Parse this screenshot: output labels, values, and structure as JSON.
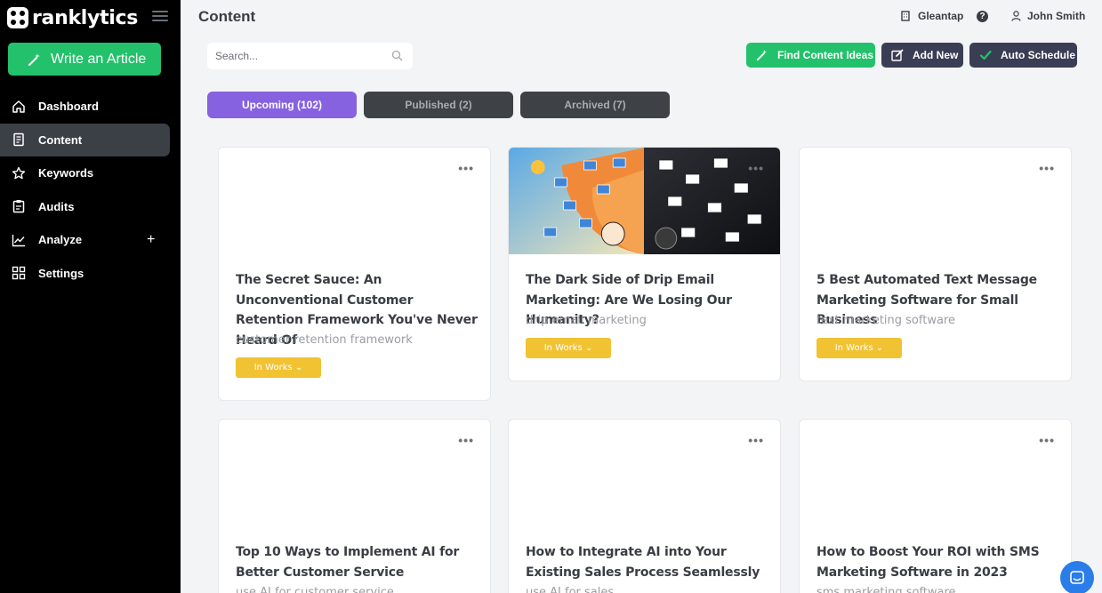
{
  "app": {
    "brand": "ranklytics"
  },
  "sidebar": {
    "write_button": "Write an Article",
    "items": [
      {
        "label": "Dashboard",
        "icon": "home-icon"
      },
      {
        "label": "Content",
        "icon": "document-icon",
        "active": true
      },
      {
        "label": "Keywords",
        "icon": "star-icon"
      },
      {
        "label": "Audits",
        "icon": "clipboard-icon"
      },
      {
        "label": "Analyze",
        "icon": "chart-line-icon",
        "expandable": "+"
      },
      {
        "label": "Settings",
        "icon": "grid-icon"
      }
    ]
  },
  "header": {
    "title": "Content",
    "workspace": "Gleantap",
    "help": "?",
    "user": "John Smith"
  },
  "search": {
    "placeholder": "Search..."
  },
  "actions": {
    "find_ideas": "Find Content Ideas",
    "add_new": "Add New",
    "auto_schedule": "Auto Schedule"
  },
  "colors": {
    "accent_green": "#23c16b",
    "dark_button": "#3a3e54",
    "tab_active": "#8661e0",
    "tab_inactive": "#3e4247",
    "status_yellow": "#f1c232"
  },
  "tabs": [
    {
      "label": "Upcoming (102)",
      "active": true
    },
    {
      "label": "Published (2)"
    },
    {
      "label": "Archived (7)"
    }
  ],
  "cards": [
    {
      "title": "The Secret Sauce: An Unconventional Customer Retention Framework You've Never Heard Of",
      "keyword": "customer retention framework",
      "status": "In Works ⌄"
    },
    {
      "title": "The Dark Side of Drip Email Marketing: Are We Losing Our Humanity?",
      "keyword": "drip email marketing",
      "status": "In Works ⌄",
      "has_image": true
    },
    {
      "title": "5 Best Automated Text Message Marketing Software for Small Business",
      "keyword": "text marketing software",
      "status": "In Works ⌄"
    },
    {
      "title": "Top 10 Ways to Implement AI for Better Customer Service",
      "keyword": "use AI for customer service"
    },
    {
      "title": "How to Integrate AI into Your Existing Sales Process Seamlessly",
      "keyword": "use AI for sales"
    },
    {
      "title": "How to Boost Your ROI with SMS Marketing Software in 2023",
      "keyword": "sms marketing software"
    }
  ]
}
